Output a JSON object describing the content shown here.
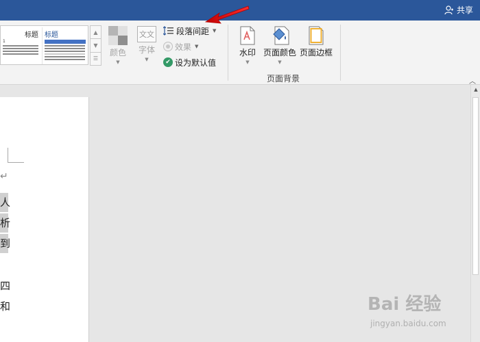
{
  "titlebar": {
    "share_label": "共享"
  },
  "ribbon": {
    "gallery": {
      "thumb1_title": "标题",
      "thumb1_sub": "1",
      "thumb2_title": "标题"
    },
    "colors_label": "颜色",
    "fonts_label": "字体",
    "fonts_icon_text": "文文",
    "paragraph_spacing_label": "段落间距",
    "effects_label": "效果",
    "set_default_label": "设为默认值",
    "watermark_label": "水印",
    "page_color_label": "页面颜色",
    "page_borders_label": "页面边框",
    "page_background_group": "页面背景",
    "accent_color": "#2b579a"
  },
  "document": {
    "return_mark": "↵",
    "visible_chars": [
      {
        "text": "人",
        "highlighted": true
      },
      {
        "text": "析",
        "highlighted": true
      },
      {
        "text": "到",
        "highlighted": true
      },
      {
        "text": "四",
        "highlighted": false
      },
      {
        "text": "和",
        "highlighted": false
      }
    ]
  },
  "watermark": {
    "brand": "Bai 经验",
    "url": "jingyan.baidu.com"
  }
}
